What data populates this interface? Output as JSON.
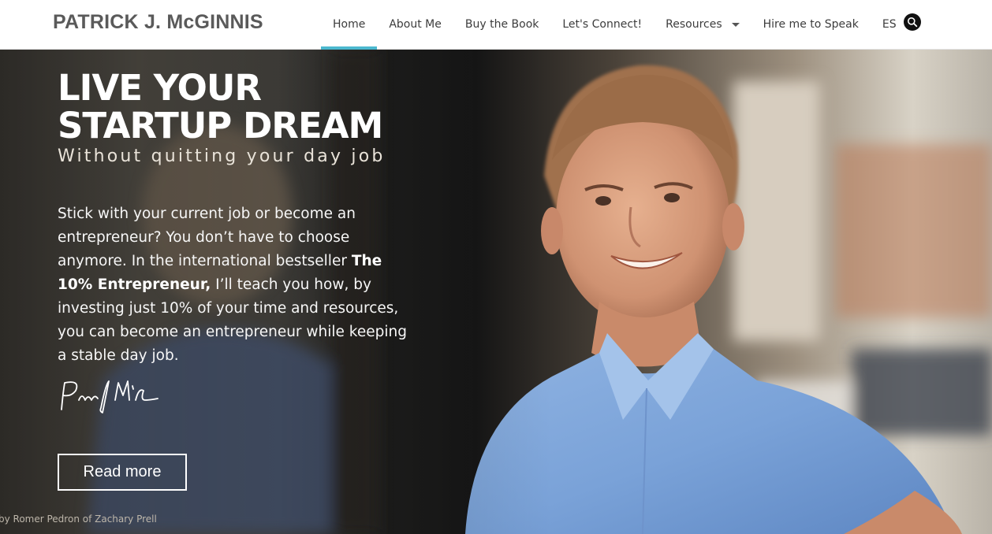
{
  "header": {
    "logo": "PATRICK J. McGINNIS",
    "nav": [
      {
        "label": "Home",
        "active": true
      },
      {
        "label": "About Me"
      },
      {
        "label": "Buy the Book"
      },
      {
        "label": "Let's Connect!"
      },
      {
        "label": "Resources",
        "dropdown": true
      },
      {
        "label": "Hire me to Speak"
      },
      {
        "label": "ES"
      }
    ],
    "search_icon": "search-icon",
    "accent_color": "#4bb8cf"
  },
  "hero": {
    "headline_line1": "LIVE YOUR",
    "headline_line2": "STARTUP DREAM",
    "subtitle": "Without quitting your day job",
    "intro_part1": "Stick with your current job or become an entrepreneur? You don’t have to choose anymore. In the international bestseller ",
    "intro_bold": "The 10% Entrepreneur,",
    "intro_part2": " I’ll teach you how, by investing just 10% of your time and resources, you can become an entrepreneur while keeping a stable day job.",
    "cta_label": "Read more",
    "photo_credit": "by Romer Pedron of Zachary Prell",
    "signature_icon": "signature-icon"
  }
}
